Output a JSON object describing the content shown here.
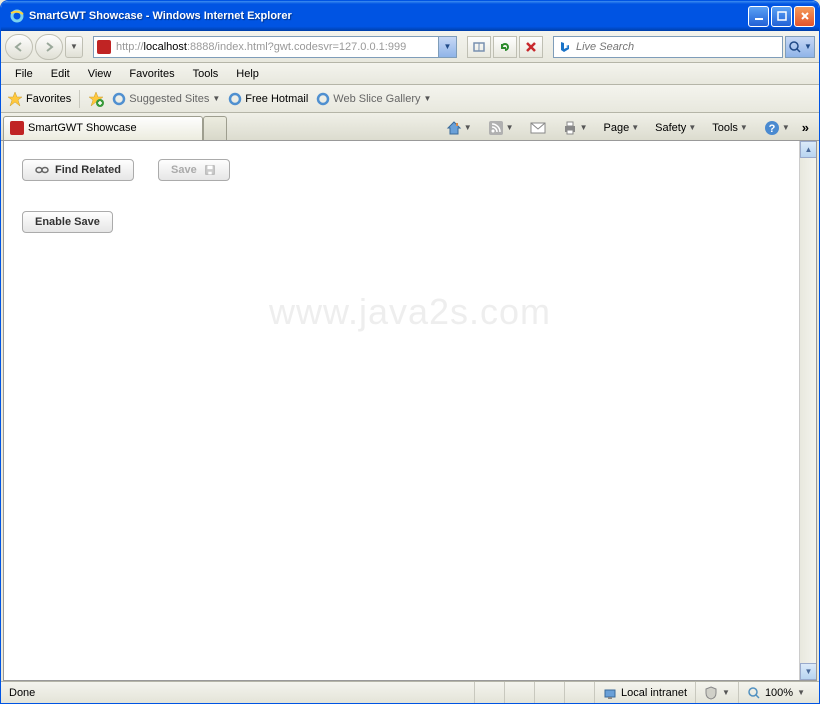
{
  "window": {
    "title": "SmartGWT Showcase - Windows Internet Explorer"
  },
  "address": {
    "prefix": "http://",
    "host": "localhost",
    "rest": ":8888/index.html?gwt.codesvr=127.0.0.1:999"
  },
  "search": {
    "placeholder": "Live Search"
  },
  "menu": {
    "file": "File",
    "edit": "Edit",
    "view": "View",
    "favorites": "Favorites",
    "tools": "Tools",
    "help": "Help"
  },
  "favbar": {
    "favorites": "Favorites",
    "suggested": "Suggested Sites",
    "hotmail": "Free Hotmail",
    "webslice": "Web Slice Gallery"
  },
  "tab": {
    "title": "SmartGWT Showcase"
  },
  "toolbar": {
    "page": "Page",
    "safety": "Safety",
    "tools": "Tools"
  },
  "content": {
    "find_related": "Find Related",
    "save": "Save",
    "enable_save": "Enable Save"
  },
  "watermark": "www.java2s.com",
  "status": {
    "done": "Done",
    "zone": "Local intranet",
    "zoom": "100%"
  }
}
